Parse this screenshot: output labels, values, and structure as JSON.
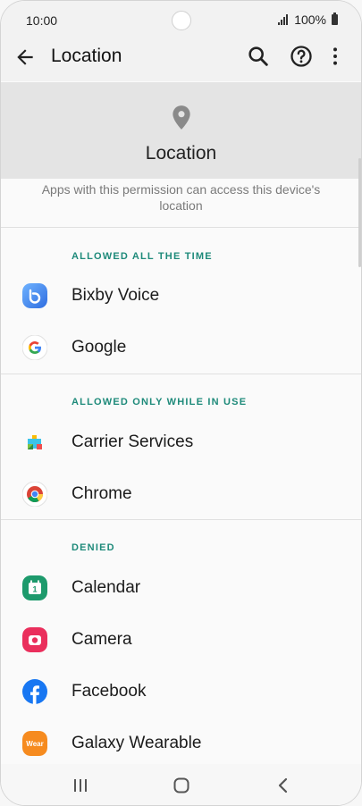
{
  "status_bar": {
    "time": "10:00",
    "battery": "100%"
  },
  "app_bar": {
    "title": "Location"
  },
  "hero": {
    "title": "Location"
  },
  "description": "Apps with this permission can access this device's location",
  "sections": [
    {
      "header": "ALLOWED ALL THE TIME",
      "apps": [
        {
          "name": "Bixby Voice"
        },
        {
          "name": "Google"
        }
      ]
    },
    {
      "header": "ALLOWED ONLY WHILE IN USE",
      "apps": [
        {
          "name": "Carrier Services"
        },
        {
          "name": "Chrome"
        }
      ]
    },
    {
      "header": "DENIED",
      "apps": [
        {
          "name": "Calendar"
        },
        {
          "name": "Camera"
        },
        {
          "name": "Facebook"
        },
        {
          "name": "Galaxy Wearable"
        }
      ]
    }
  ],
  "icons": {
    "calendar_day": "1",
    "wearable_text": "Wear"
  },
  "colors": {
    "accent": "#1e8a7a",
    "hero_bg": "#e4e4e4",
    "app_bar_bg": "#f2f2f2"
  }
}
